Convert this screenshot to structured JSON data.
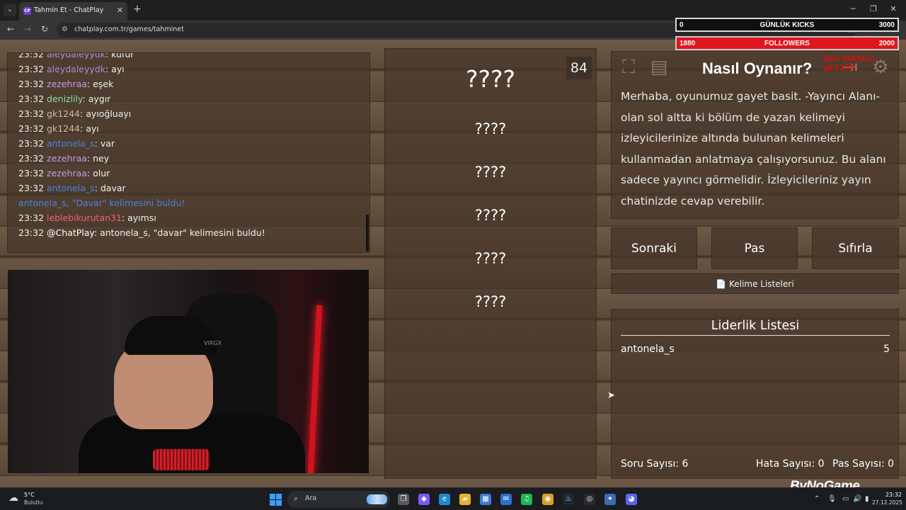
{
  "browser": {
    "tab_title": "Tahmin Et - ChatPlay",
    "tab_favicon_text": "CP",
    "url": "chatplay.com.tr/games/tahminet",
    "tab_list_glyph": "⌄",
    "tab_close_glyph": "✕",
    "new_tab_glyph": "+",
    "back_glyph": "←",
    "forward_glyph": "→",
    "reload_glyph": "↻",
    "minimize_glyph": "─",
    "restore_glyph": "❐",
    "close_glyph": "✕",
    "site_icon_glyph": "⚙",
    "star_glyph": "☆",
    "extensions_glyph": "⬚"
  },
  "overlay": {
    "kicks": {
      "left": "0",
      "label": "GÜNLÜK KICKS",
      "right": "3000"
    },
    "followers": {
      "left": "1880",
      "label": "FOLLOWERS",
      "right": "2000"
    },
    "red_text": "Son takipçi: gk1244"
  },
  "chat": {
    "lines": [
      {
        "time": "23:32",
        "user": "aleydaleyydk",
        "user_color": "#b88ad6",
        "message": "küfür"
      },
      {
        "time": "23:32",
        "user": "aleydaleyydk",
        "user_color": "#b88ad6",
        "message": "ayı"
      },
      {
        "time": "23:32",
        "user": "zezehraa",
        "user_color": "#c59be3",
        "message": "eşek"
      },
      {
        "time": "23:32",
        "user": "denizlily",
        "user_color": "#8fe0a0",
        "message": "aygır"
      },
      {
        "time": "23:32",
        "user": "gk1244",
        "user_color": "#d8b7a4",
        "message": "ayıoğluayı"
      },
      {
        "time": "23:32",
        "user": "gk1244",
        "user_color": "#d8b7a4",
        "message": "ayı"
      },
      {
        "time": "23:32",
        "user": "antonela_s",
        "user_color": "#4f7fe0",
        "message": "var"
      },
      {
        "time": "23:32",
        "user": "zezehraa",
        "user_color": "#c59be3",
        "message": "ney"
      },
      {
        "time": "23:32",
        "user": "zezehraa",
        "user_color": "#c59be3",
        "message": "olur"
      },
      {
        "time": "23:32",
        "user": "antonela_s",
        "user_color": "#4f7fe0",
        "message": "davar"
      },
      {
        "time": "",
        "user": "antonela_s, \"Davar\" kelimesini buldu!",
        "user_color": "#4f7fe0",
        "message": "",
        "system": true
      },
      {
        "time": "23:32",
        "user": "leblebikurutan31",
        "user_color": "#f06070",
        "message": "ayımsı"
      },
      {
        "time": "23:32",
        "user": "@ChatPlay",
        "user_color": "#ffffff",
        "message": "antonela_s, \"davar\" kelimesini buldu!"
      }
    ]
  },
  "camera": {
    "logo_text": "VIRGX"
  },
  "game": {
    "timer": "84",
    "main_word": "????",
    "taboo_words": [
      "????",
      "????",
      "????",
      "????",
      "????"
    ]
  },
  "howto": {
    "title": "Nasıl Oynanır?",
    "text": "Merhaba, oyunumuz gayet basit. -Yayıncı Alanı-olan sol altta ki bölüm de yazan kelimeyi izleyicilerinize altında bulunan kelimeleri kullanmadan anlatmaya çalışıyorsunuz. Bu alanı sadece yayıncı görmelidir. İzleyicileriniz yayın chatinizde cevap verebilir.",
    "icons": {
      "fullscreen": "⛶",
      "list": "▤",
      "exit": "⇥",
      "settings": "⚙"
    }
  },
  "actions": {
    "next": "Sonraki",
    "pass": "Pas",
    "reset": "Sıfırla",
    "word_lists": "Kelime Listeleri",
    "word_lists_icon": "📄"
  },
  "leaderboard": {
    "title": "Liderlik Listesi",
    "entries": [
      {
        "name": "antonela_s",
        "score": "5"
      }
    ],
    "stats": {
      "questions": "Soru Sayısı: 6",
      "errors": "Hata Sayısı: 0",
      "passes": "Pas Sayısı: 0"
    }
  },
  "branding": {
    "bynogame": "ByNoGame"
  },
  "taskbar": {
    "weather_temp": "5°C",
    "weather_desc": "Bulutlu",
    "weather_icon": "☁",
    "search_label": "Ara",
    "search_icon": "⌕",
    "apps": [
      {
        "name": "task-view",
        "glyph": "❐",
        "color": "#5a5a5a"
      },
      {
        "name": "copilot",
        "glyph": "◆",
        "color": "#7a5af5"
      },
      {
        "name": "edge",
        "glyph": "e",
        "color": "#1f8ad2"
      },
      {
        "name": "file-explorer",
        "glyph": "▰",
        "color": "#e8b230"
      },
      {
        "name": "store",
        "glyph": "▦",
        "color": "#3b7bd8"
      },
      {
        "name": "mail",
        "glyph": "✉",
        "color": "#2a6fd0"
      },
      {
        "name": "spotify",
        "glyph": "♫",
        "color": "#1db954"
      },
      {
        "name": "chrome",
        "glyph": "◉",
        "color": "#d8a02a"
      },
      {
        "name": "steam",
        "glyph": "♨",
        "color": "#1b2838"
      },
      {
        "name": "obs",
        "glyph": "◎",
        "color": "#2a2a2a"
      },
      {
        "name": "settings-app",
        "glyph": "✦",
        "color": "#3c6bb5"
      },
      {
        "name": "discord",
        "glyph": "◕",
        "color": "#5865f2"
      }
    ],
    "tray": {
      "chevron": "⌃",
      "mic": "🎙",
      "network": "▭",
      "volume": "🔊",
      "battery": "▮"
    },
    "time": "23:32",
    "date": "27.12.2025"
  }
}
